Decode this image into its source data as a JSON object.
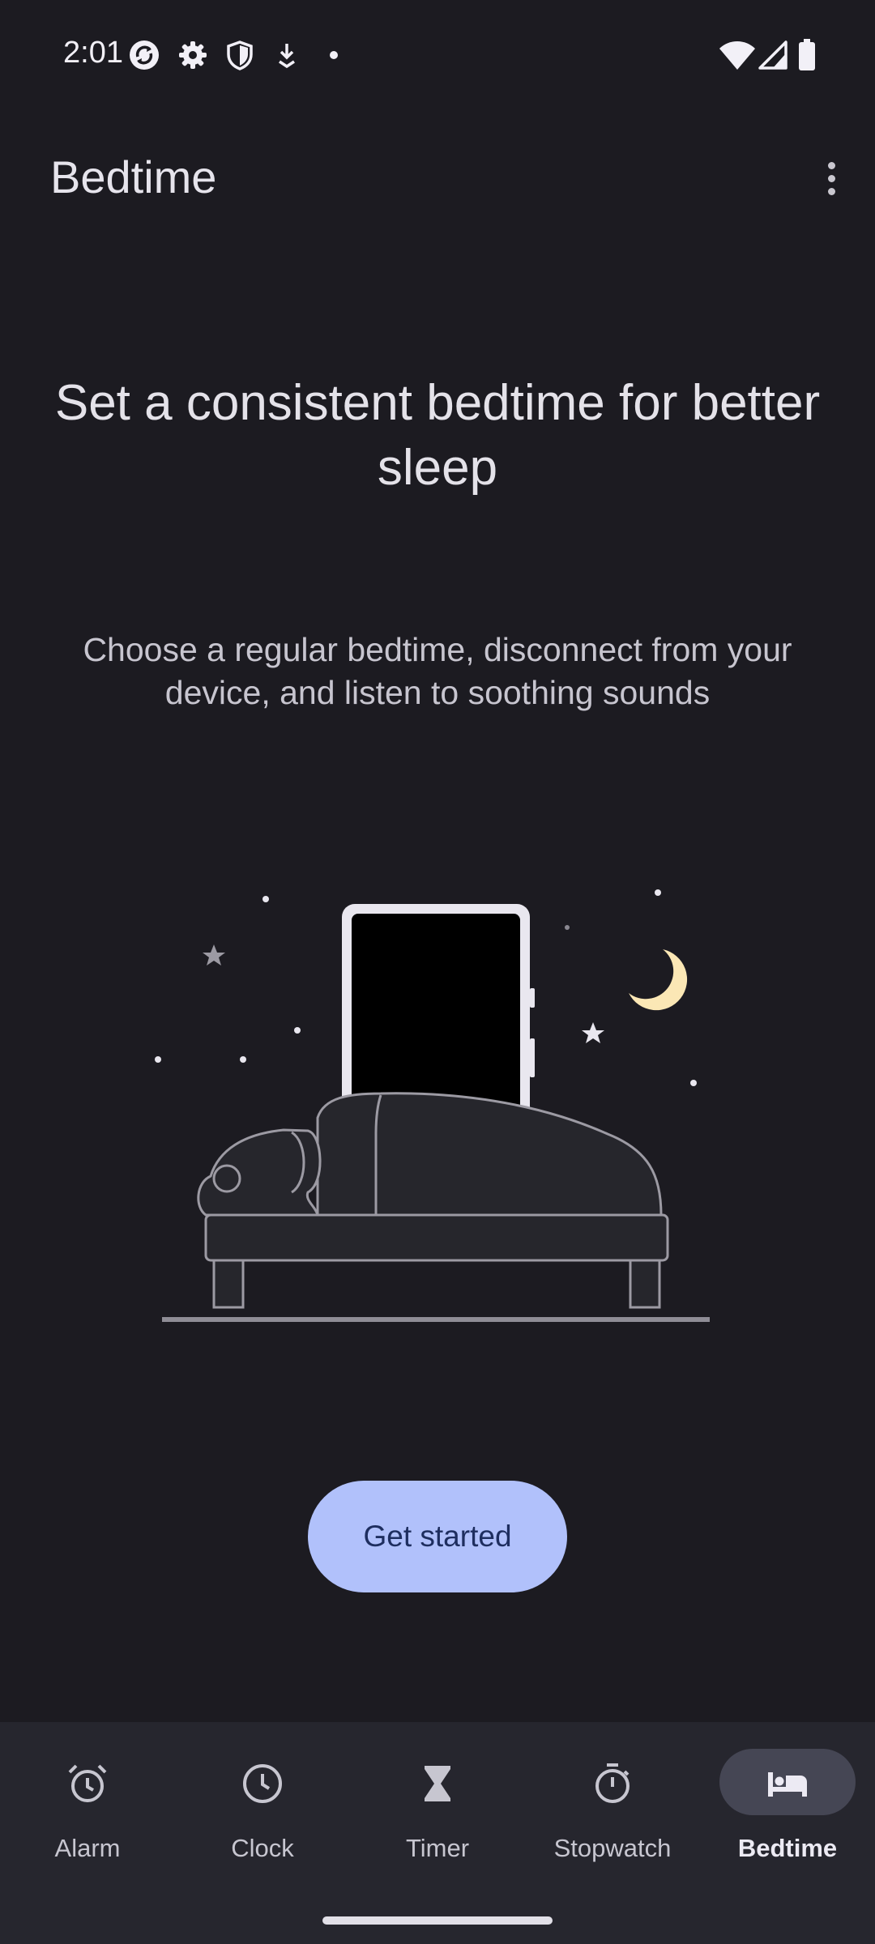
{
  "status_bar": {
    "time": "2:01",
    "left_icons": [
      "sync-icon",
      "settings-icon",
      "shield-icon",
      "download-icon",
      "dot-icon"
    ],
    "right_icons": [
      "wifi-icon",
      "cellular-signal-icon",
      "battery-icon"
    ]
  },
  "app_bar": {
    "title": "Bedtime",
    "overflow_icon": "more-vertical-icon"
  },
  "main": {
    "headline": "Set a consistent bedtime for better sleep",
    "subtext": "Choose a regular bedtime, disconnect from your device, and listen to soothing sounds",
    "illustration_icon": "sleeping-person-with-phone-illustration",
    "cta_label": "Get started"
  },
  "bottom_nav": {
    "items": [
      {
        "label": "Alarm",
        "icon": "alarm-clock-icon",
        "active": false
      },
      {
        "label": "Clock",
        "icon": "clock-icon",
        "active": false
      },
      {
        "label": "Timer",
        "icon": "hourglass-icon",
        "active": false
      },
      {
        "label": "Stopwatch",
        "icon": "stopwatch-icon",
        "active": false
      },
      {
        "label": "Bedtime",
        "icon": "bed-icon",
        "active": true
      }
    ]
  },
  "colors": {
    "background": "#1c1b21",
    "nav_background": "#26262e",
    "accent_button": "#b1c1fb",
    "active_pill": "#454654",
    "moon": "#fbe7b5"
  }
}
